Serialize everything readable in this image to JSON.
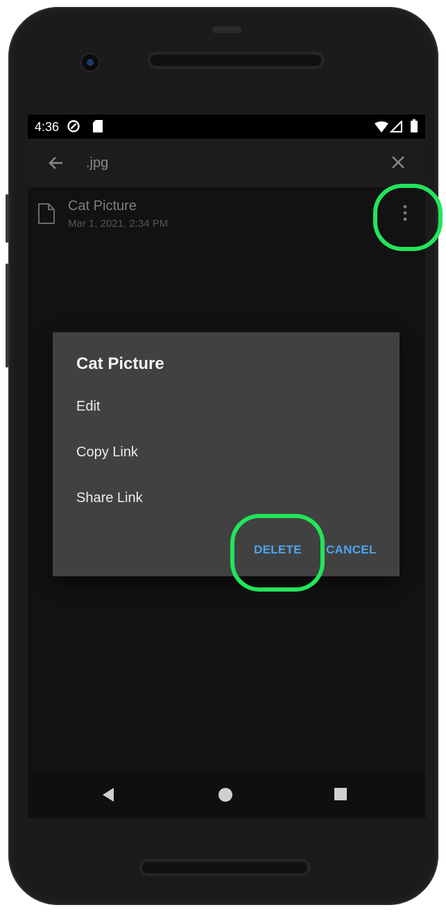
{
  "status_bar": {
    "time": "4:36",
    "icons": [
      "do-not-disturb-icon",
      "sd-card-icon",
      "wifi-icon",
      "signal-icon",
      "battery-icon"
    ]
  },
  "search_bar": {
    "back_icon": "arrow-left-icon",
    "query": ".jpg",
    "close_icon": "close-icon"
  },
  "result_item": {
    "icon": "file-icon",
    "title": "Cat Picture",
    "subtitle": "Mar 1, 2021, 2:34 PM",
    "menu_icon": "more-vertical-icon"
  },
  "dialog": {
    "title": "Cat Picture",
    "options": [
      "Edit",
      "Copy Link",
      "Share Link"
    ],
    "delete_label": "DELETE",
    "cancel_label": "CANCEL"
  },
  "navigation_bar": {
    "icons": [
      "back-icon",
      "home-icon",
      "recents-icon"
    ]
  },
  "colors": {
    "accent": "#4aa6f0",
    "highlight": "#22e55a",
    "dialog_bg": "#414141",
    "screen_bg": "#121212"
  }
}
